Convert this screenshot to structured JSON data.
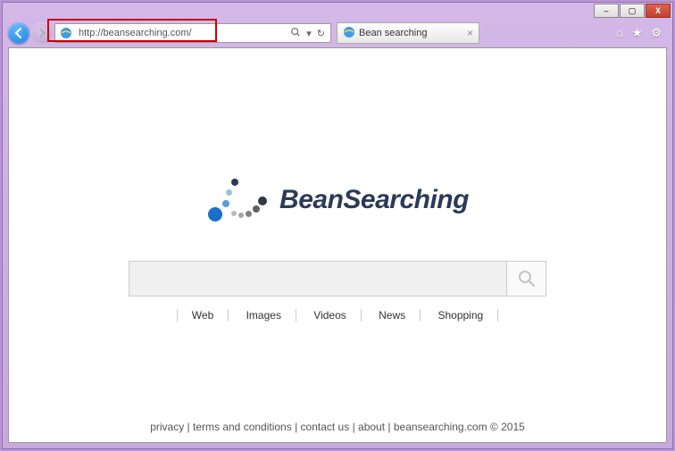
{
  "window": {
    "minimize": "–",
    "maximize": "▢",
    "close": "X"
  },
  "toolbar": {
    "back": "←",
    "forward": "→",
    "url": "http://beansearching.com/",
    "search_glyph": "🔍",
    "dropdown": "▾",
    "refresh": "↻"
  },
  "tab": {
    "title": "Bean searching",
    "close": "×"
  },
  "chrome_icons": {
    "home": "⌂",
    "favorites": "★",
    "tools": "⚙"
  },
  "page": {
    "logo_text": "BeanSearching",
    "search_value": "",
    "nav": [
      "Web",
      "Images",
      "Videos",
      "News",
      "Shopping"
    ],
    "footer": {
      "links": [
        "privacy",
        "terms and conditions",
        "contact us",
        "about"
      ],
      "copyright": "beansearching.com © 2015"
    }
  }
}
